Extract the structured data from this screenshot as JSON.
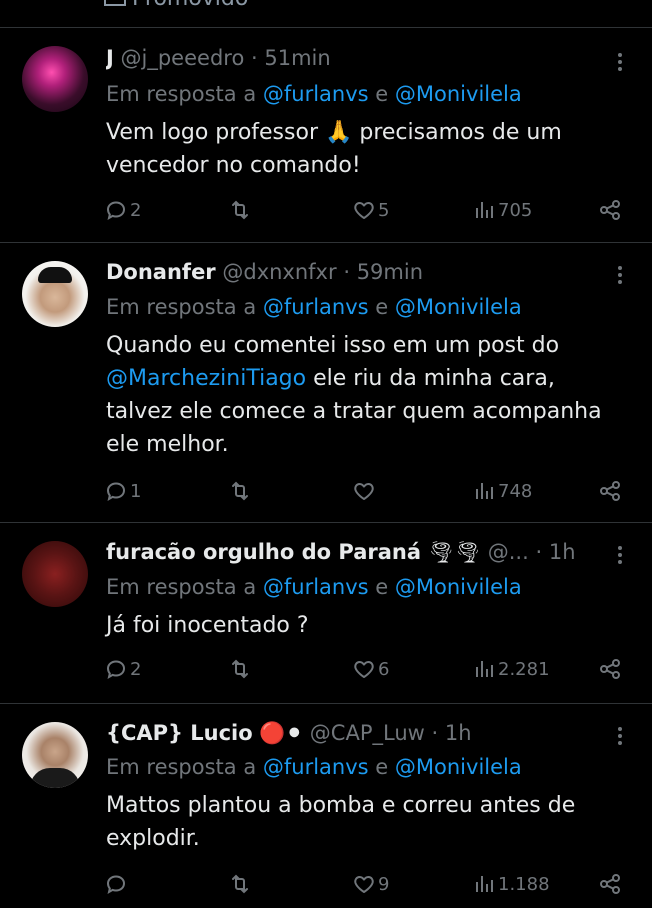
{
  "top": {
    "label": "Promovido"
  },
  "reply_to_prefix": "Em resposta a",
  "reply_to_conj": "e",
  "tweets": [
    {
      "name": "J",
      "handle": "@j_peeedro",
      "dot": "·",
      "time": "51min",
      "mention1": "@furlanvs",
      "mention2": "@Monivilela",
      "text1": "Vem logo professor 🙏 precisamos de um",
      "text2": "vencedor no comando!",
      "replies": "2",
      "retweets": "",
      "likes": "5",
      "views": "705",
      "avatar_color": "#3a0d2a"
    },
    {
      "name": "Donanfer",
      "handle": "@dxnxnfxr",
      "dot": "·",
      "time": "59min",
      "mention1": "@furlanvs",
      "mention2": "@Monivilela",
      "text_mention": "@MarcheziniTiago",
      "text_after": " ele riu da minha cara,",
      "text1": "Quando eu comentei isso em um post do",
      "text3": "talvez ele comece a tratar quem acompanha",
      "text4": "ele melhor.",
      "replies": "1",
      "retweets": "",
      "likes": "",
      "views": "748",
      "avatar_color": "#d8d3c8"
    },
    {
      "name": "furacão orgulho do Paraná",
      "name_emoji": "🌪🌪",
      "handle": "@...",
      "dot": "·",
      "time": "1h",
      "mention1": "@furlanvs",
      "mention2": "@Monivilela",
      "text1": "Já foi inocentado ?",
      "replies": "2",
      "retweets": "",
      "likes": "6",
      "views": "2.281",
      "avatar_color": "#5a1414"
    },
    {
      "name": "{CAP} Lucio",
      "name_emoji": "🔴⚫",
      "handle": "@CAP_Luw",
      "dot": "·",
      "time": "1h",
      "mention1": "@furlanvs",
      "mention2": "@Monivilela",
      "text1": "Mattos plantou a bomba e correu antes de",
      "text2": "explodir.",
      "replies": "",
      "retweets": "",
      "likes": "9",
      "views": "1.188",
      "avatar_color": "#e8e4df"
    }
  ],
  "icons": {
    "reply": "reply-icon",
    "retweet": "retweet-icon",
    "like": "heart-icon",
    "views": "views-icon",
    "share": "share-icon",
    "more": "more-icon"
  },
  "colors": {
    "background": "#000000",
    "text": "#e7e9ea",
    "muted": "#71767b",
    "link": "#1d9bf0",
    "divider": "#2f3336"
  }
}
